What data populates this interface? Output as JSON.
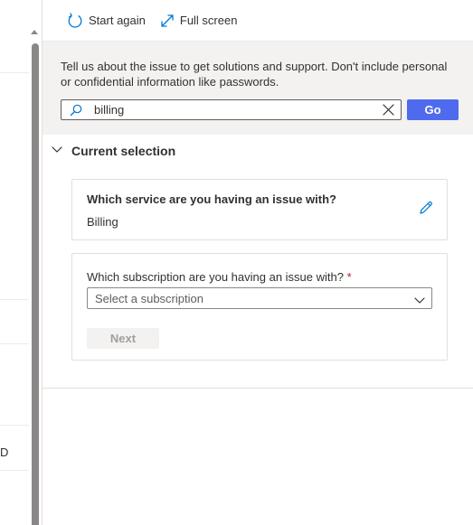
{
  "toolbar": {
    "start_again_label": "Start again",
    "full_screen_label": "Full screen"
  },
  "search": {
    "hint": "Tell us about the issue to get solutions and support. Don't include personal or confidential information like passwords.",
    "value": "billing",
    "go_label": "Go"
  },
  "current_selection": {
    "title": "Current selection",
    "service_question": "Which service are you having an issue with?",
    "service_answer": "Billing"
  },
  "subscription": {
    "question": "Which subscription are you having an issue with?",
    "required_marker": "*",
    "placeholder": "Select a subscription",
    "next_label": "Next"
  },
  "background_page": {
    "fragment": "D"
  },
  "colors": {
    "accent": "#4f6bed",
    "band": "#f3f2f1",
    "required": "#a4262c"
  }
}
